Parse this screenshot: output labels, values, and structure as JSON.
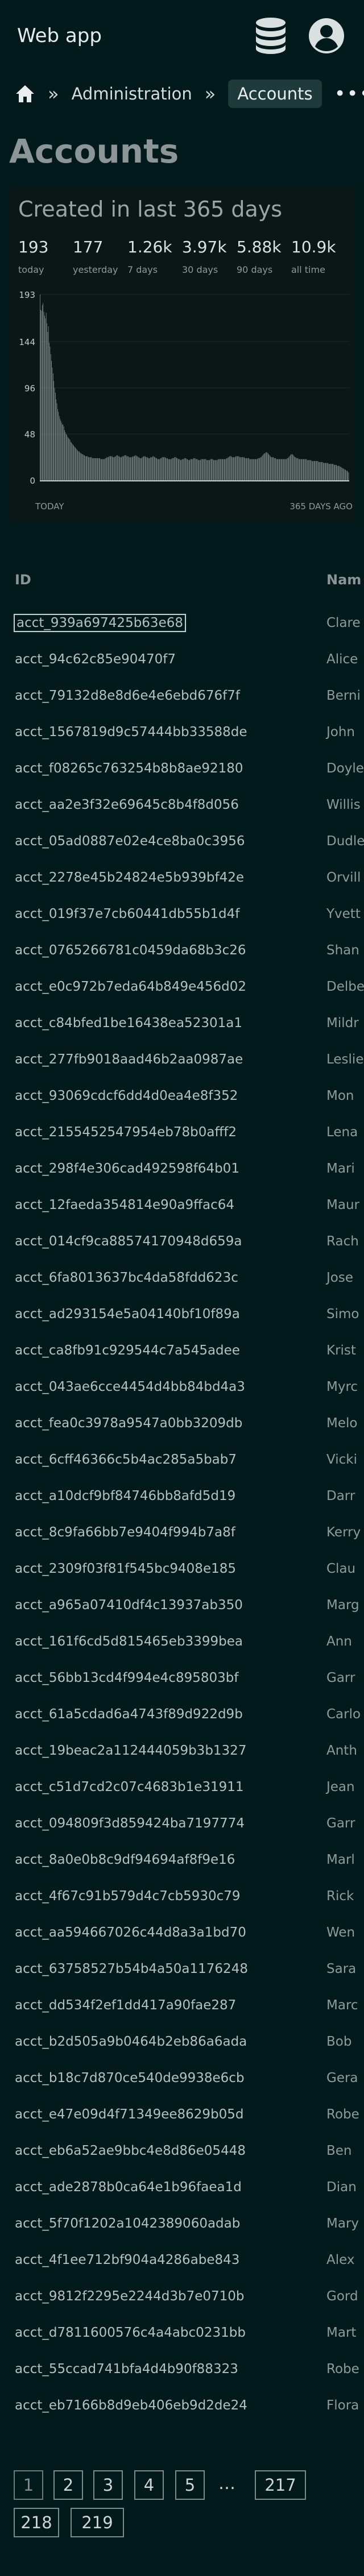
{
  "header": {
    "app_title": "Web app",
    "icons": [
      "database-icon",
      "user-avatar-icon"
    ]
  },
  "breadcrumb": {
    "home_icon": "home-icon",
    "separator": "»",
    "items": [
      "Administration",
      "Accounts"
    ],
    "more": "•••"
  },
  "page": {
    "title": "Accounts"
  },
  "stats": {
    "heading": "Created in last 365 days",
    "items": [
      {
        "value": "193",
        "label": "today"
      },
      {
        "value": "177",
        "label": "yesterday"
      },
      {
        "value": "1.26k",
        "label": "7 days"
      },
      {
        "value": "3.97k",
        "label": "30 days"
      },
      {
        "value": "5.88k",
        "label": "90 days"
      },
      {
        "value": "10.9k",
        "label": "all time"
      }
    ]
  },
  "chart_data": {
    "type": "bar",
    "title": "",
    "xlabel": "",
    "ylabel": "",
    "x_tick_labels": [
      "TODAY",
      "365 DAYS AGO"
    ],
    "y_ticks": [
      0,
      48,
      96,
      144,
      193
    ],
    "ylim": [
      0,
      193
    ],
    "values": [
      193,
      177,
      176,
      182,
      184,
      175,
      171,
      168,
      174,
      163,
      154,
      160,
      143,
      139,
      131,
      124,
      117,
      111,
      103,
      96,
      91,
      84,
      80,
      74,
      71,
      67,
      64,
      62,
      60,
      58,
      58,
      56,
      52,
      50,
      48,
      47,
      45,
      44,
      43,
      42,
      40,
      39,
      38,
      37,
      36,
      35,
      34,
      33,
      32,
      31,
      30,
      30,
      29,
      28,
      28,
      27,
      27,
      26,
      26,
      25,
      25,
      25,
      25,
      24,
      24,
      24,
      24,
      24,
      23,
      23,
      23,
      23,
      23,
      23,
      23,
      23,
      23,
      23,
      23,
      22,
      22,
      22,
      22,
      22,
      22,
      23,
      23,
      24,
      24,
      24,
      25,
      25,
      25,
      25,
      25,
      24,
      24,
      24,
      25,
      25,
      26,
      26,
      25,
      25,
      24,
      24,
      24,
      25,
      25,
      25,
      26,
      26,
      26,
      25,
      25,
      25,
      24,
      24,
      24,
      24,
      24,
      25,
      25,
      25,
      26,
      26,
      25,
      25,
      24,
      24,
      23,
      23,
      23,
      24,
      24,
      25,
      25,
      25,
      24,
      24,
      24,
      23,
      23,
      23,
      24,
      24,
      24,
      25,
      25,
      24,
      24,
      23,
      23,
      22,
      22,
      22,
      22,
      23,
      23,
      24,
      24,
      24,
      24,
      24,
      23,
      23,
      23,
      22,
      22,
      22,
      22,
      22,
      23,
      23,
      23,
      24,
      24,
      24,
      23,
      23,
      22,
      22,
      22,
      21,
      21,
      22,
      22,
      22,
      23,
      23,
      23,
      22,
      22,
      21,
      21,
      21,
      22,
      22,
      22,
      22,
      23,
      23,
      23,
      22,
      22,
      22,
      21,
      21,
      21,
      21,
      22,
      22,
      22,
      22,
      22,
      22,
      22,
      21,
      21,
      21,
      21,
      21,
      22,
      22,
      22,
      22,
      21,
      21,
      21,
      21,
      21,
      21,
      22,
      22,
      22,
      22,
      22,
      22,
      22,
      22,
      22,
      22,
      22,
      23,
      23,
      24,
      24,
      25,
      25,
      25,
      24,
      24,
      24,
      24,
      24,
      25,
      25,
      25,
      25,
      25,
      24,
      24,
      24,
      24,
      24,
      24,
      24,
      23,
      23,
      23,
      23,
      23,
      23,
      22,
      22,
      22,
      22,
      22,
      22,
      22,
      22,
      22,
      22,
      22,
      23,
      23,
      23,
      24,
      24,
      25,
      26,
      27,
      28,
      28,
      29,
      29,
      29,
      28,
      27,
      26,
      25,
      24,
      24,
      24,
      24,
      23,
      23,
      23,
      22,
      22,
      22,
      22,
      22,
      22,
      22,
      22,
      22,
      22,
      22,
      22,
      22,
      22,
      23,
      23,
      24,
      25,
      26,
      27,
      27,
      27,
      26,
      25,
      24,
      24,
      23,
      23,
      23,
      22,
      22,
      22,
      22,
      22,
      22,
      22,
      22,
      22,
      22,
      22,
      21,
      21,
      21,
      21,
      21,
      21,
      20,
      20,
      20,
      20,
      20,
      20,
      20,
      20,
      20,
      19,
      19,
      19,
      19,
      19,
      19,
      18,
      18,
      18,
      18,
      18,
      18,
      18,
      17,
      17,
      17,
      17,
      17,
      17,
      17,
      16,
      16,
      16,
      16,
      15,
      15,
      15,
      15,
      14,
      14,
      13,
      13,
      12,
      12,
      11,
      11,
      10,
      10,
      9,
      8
    ]
  },
  "table": {
    "columns": [
      "ID",
      "Nam"
    ],
    "rows": [
      {
        "id": "acct_939a697425b63e68",
        "name": "Clare"
      },
      {
        "id": "acct_94c62c85e90470f7",
        "name": "Alice"
      },
      {
        "id": "acct_79132d8e8d6e4e6ebd676f7f",
        "name": "Berni"
      },
      {
        "id": "acct_1567819d9c57444bb33588de",
        "name": "John"
      },
      {
        "id": "acct_f08265c763254b8b8ae92180",
        "name": "Doyle"
      },
      {
        "id": "acct_aa2e3f32e69645c8b4f8d056",
        "name": "Willis"
      },
      {
        "id": "acct_05ad0887e02e4ce8ba0c3956",
        "name": "Dudle"
      },
      {
        "id": "acct_2278e45b24824e5b939bf42e",
        "name": "Orvill"
      },
      {
        "id": "acct_019f37e7cb60441db55b1d4f",
        "name": "Yvett"
      },
      {
        "id": "acct_0765266781c0459da68b3c26",
        "name": "Shan"
      },
      {
        "id": "acct_e0c972b7eda64b849e456d02",
        "name": "Delbe"
      },
      {
        "id": "acct_c84bfed1be16438ea52301a1",
        "name": "Mildr"
      },
      {
        "id": "acct_277fb9018aad46b2aa0987ae",
        "name": "Leslie"
      },
      {
        "id": "acct_93069cdcf6dd4d0ea4e8f352",
        "name": "Mon"
      },
      {
        "id": "acct_2155452547954eb78b0afff2",
        "name": "Lena"
      },
      {
        "id": "acct_298f4e306cad492598f64b01",
        "name": "Mari"
      },
      {
        "id": "acct_12faeda354814e90a9ffac64",
        "name": "Maur"
      },
      {
        "id": "acct_014cf9ca88574170948d659a",
        "name": "Rach"
      },
      {
        "id": "acct_6fa8013637bc4da58fdd623c",
        "name": "Jose"
      },
      {
        "id": "acct_ad293154e5a04140bf10f89a",
        "name": "Simo"
      },
      {
        "id": "acct_ca8fb91c929544c7a545adee",
        "name": "Krist"
      },
      {
        "id": "acct_043ae6cce4454d4bb84bd4a3",
        "name": "Myrc"
      },
      {
        "id": "acct_fea0c3978a9547a0bb3209db",
        "name": "Melo"
      },
      {
        "id": "acct_6cff46366c5b4ac285a5bab7",
        "name": "Vicki"
      },
      {
        "id": "acct_a10dcf9bf84746bb8afd5d19",
        "name": "Darr"
      },
      {
        "id": "acct_8c9fa66bb7e9404f994b7a8f",
        "name": "Kerry"
      },
      {
        "id": "acct_2309f03f81f545bc9408e185",
        "name": "Clau"
      },
      {
        "id": "acct_a965a07410df4c13937ab350",
        "name": "Marg"
      },
      {
        "id": "acct_161f6cd5d815465eb3399bea",
        "name": "Ann"
      },
      {
        "id": "acct_56bb13cd4f994e4c895803bf",
        "name": "Garr"
      },
      {
        "id": "acct_61a5cdad6a4743f89d922d9b",
        "name": "Carlo"
      },
      {
        "id": "acct_19beac2a112444059b3b1327",
        "name": "Anth"
      },
      {
        "id": "acct_c51d7cd2c07c4683b1e31911",
        "name": "Jean"
      },
      {
        "id": "acct_094809f3d859424ba7197774",
        "name": "Garr"
      },
      {
        "id": "acct_8a0e0b8c9df94694af8f9e16",
        "name": "Marl"
      },
      {
        "id": "acct_4f67c91b579d4c7cb5930c79",
        "name": "Rick"
      },
      {
        "id": "acct_aa594667026c44d8a3a1bd70",
        "name": "Wen"
      },
      {
        "id": "acct_63758527b54b4a50a1176248",
        "name": "Sara"
      },
      {
        "id": "acct_dd534f2ef1dd417a90fae287",
        "name": "Marc"
      },
      {
        "id": "acct_b2d505a9b0464b2eb86a6ada",
        "name": "Bob"
      },
      {
        "id": "acct_b18c7d870ce540de9938e6cb",
        "name": "Gera"
      },
      {
        "id": "acct_e47e09d4f71349ee8629b05d",
        "name": "Robe"
      },
      {
        "id": "acct_eb6a52ae9bbc4e8d86e05448",
        "name": "Ben"
      },
      {
        "id": "acct_ade2878b0ca64e1b96faea1d",
        "name": "Dian"
      },
      {
        "id": "acct_5f70f1202a1042389060adab",
        "name": "Mary"
      },
      {
        "id": "acct_4f1ee712bf904a4286abe843",
        "name": "Alex"
      },
      {
        "id": "acct_9812f2295e2244d3b7e0710b",
        "name": "Gord"
      },
      {
        "id": "acct_d7811600576c4a4abc0231bb",
        "name": "Mart"
      },
      {
        "id": "acct_55ccad741bfa4d4b90f88323",
        "name": "Robe"
      },
      {
        "id": "acct_eb7166b8d9eb406eb9d2de24",
        "name": "Flora"
      }
    ]
  },
  "pagination": {
    "pages": [
      "1",
      "2",
      "3",
      "4",
      "5"
    ],
    "ellipsis": "…",
    "last_pages": [
      "217",
      "218",
      "219"
    ],
    "current": "1"
  }
}
